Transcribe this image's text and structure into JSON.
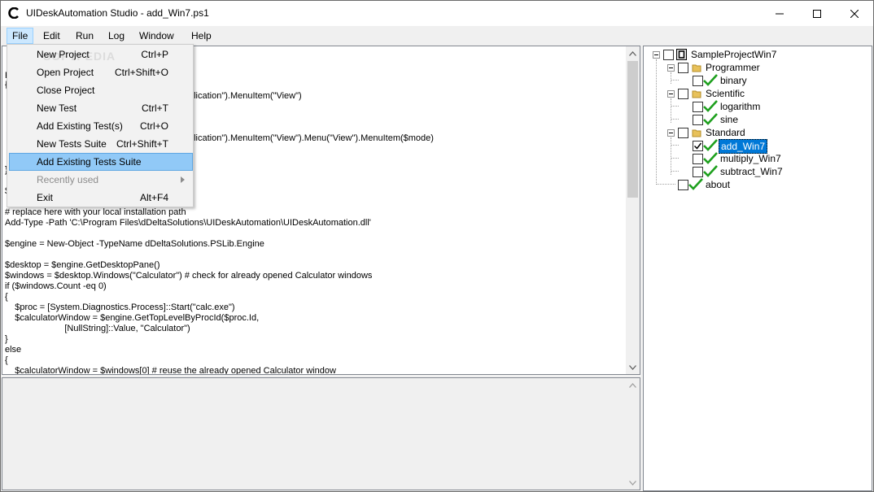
{
  "window": {
    "title": "UIDeskAutomation Studio - add_Win7.ps1",
    "watermark": "SOFTPEDIA"
  },
  "menubar": {
    "items": [
      "File",
      "Edit",
      "Run",
      "Log",
      "Window",
      "Help"
    ]
  },
  "file_menu": {
    "items": [
      {
        "label": "New Project",
        "shortcut": "Ctrl+P"
      },
      {
        "label": "Open Project",
        "shortcut": "Ctrl+Shift+O"
      },
      {
        "label": "Close Project",
        "shortcut": ""
      },
      {
        "label": "New Test",
        "shortcut": "Ctrl+T"
      },
      {
        "label": "Add Existing Test(s)",
        "shortcut": "Ctrl+O"
      },
      {
        "label": "New Tests Suite",
        "shortcut": "Ctrl+Shift+T"
      },
      {
        "label": "Add Existing Tests Suite",
        "shortcut": ""
      },
      {
        "label": "Recently used",
        "shortcut": ""
      },
      {
        "label": "Exit",
        "shortcut": "Alt+F4"
      }
    ]
  },
  "editor": {
    "visible_fragments": [
      "plication\").MenuItem(\"View\")",
      "plication\").MenuItem(\"View\").Menu(\"View\").MenuItem($mode)"
    ],
    "lines": [
      "# replace here with your local installation path",
      "Add-Type -Path 'C:\\Program Files\\dDeltaSolutions\\UIDeskAutomation\\UIDeskAutomation.dll'",
      "",
      "$engine = New-Object -TypeName dDeltaSolutions.PSLib.Engine",
      "",
      "$desktop = $engine.GetDesktopPane()",
      "$windows = $desktop.Windows(\"Calculator\") # check for already opened Calculator windows",
      "if ($windows.Count -eq 0)",
      "{",
      "    $proc = [System.Diagnostics.Process]::Start(\"calc.exe\")",
      "    $calculatorWindow = $engine.GetTopLevelByProcId($proc.Id,",
      "                        [NullString]::Value, \"Calculator\")",
      "}",
      "else",
      "{",
      "    $calculatorWindow = $windows[0] # reuse the already opened Calculator window"
    ],
    "edge_chars": [
      "F",
      "{",
      "}",
      "$"
    ]
  },
  "tree": {
    "root": "SampleProjectWin7",
    "nodes": [
      {
        "label": "Programmer"
      },
      {
        "label": "binary"
      },
      {
        "label": "Scientific"
      },
      {
        "label": "logarithm"
      },
      {
        "label": "sine"
      },
      {
        "label": "Standard"
      },
      {
        "label": "add_Win7"
      },
      {
        "label": "multiply_Win7"
      },
      {
        "label": "subtract_Win7"
      },
      {
        "label": "about"
      }
    ]
  },
  "colors": {
    "selection": "#0078d7",
    "menu_highlight": "#91c9f7",
    "check_green": "#1ea01e",
    "folder_yellow": "#e8c15a"
  }
}
